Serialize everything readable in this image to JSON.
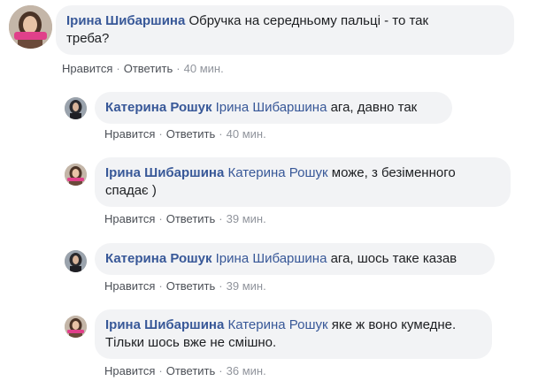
{
  "comments": [
    {
      "author": "Ірина Шибаршина",
      "mention": "",
      "text_lines": [
        "Обручка на середньому пальці - то так",
        "треба?"
      ],
      "like": "Нравится",
      "reply": "Ответить",
      "time": "40 мин.",
      "avatar": "woman-avatar-pink-badge"
    },
    {
      "author": "Катерина Рошук",
      "mention": "Ірина Шибаршина",
      "text_lines": [
        "ага, давно так"
      ],
      "like": "Нравится",
      "reply": "Ответить",
      "time": "40 мин.",
      "avatar": "woman-avatar-dark"
    },
    {
      "author": "Ірина Шибаршина",
      "mention": "Катерина Рошук",
      "text_lines": [
        "може, з безіменного",
        "спадає )"
      ],
      "like": "Нравится",
      "reply": "Ответить",
      "time": "39 мин.",
      "avatar": "woman-avatar-pink-badge"
    },
    {
      "author": "Катерина Рошук",
      "mention": "Ірина Шибаршина",
      "text_lines": [
        "ага, шось таке казав"
      ],
      "like": "Нравится",
      "reply": "Ответить",
      "time": "39 мин.",
      "avatar": "woman-avatar-dark"
    },
    {
      "author": "Ірина Шибаршина",
      "mention": "Катерина Рошук",
      "text_lines": [
        "яке ж воно кумедне.",
        "Тільки шось вже не смішно."
      ],
      "like": "Нравится",
      "reply": "Ответить",
      "time": "36 мин.",
      "avatar": "woman-avatar-pink-badge"
    }
  ],
  "separator": "·",
  "colors": {
    "link": "#385898",
    "bubble": "#f2f3f5",
    "meta": "#90949c",
    "badge": "#e0408a"
  }
}
